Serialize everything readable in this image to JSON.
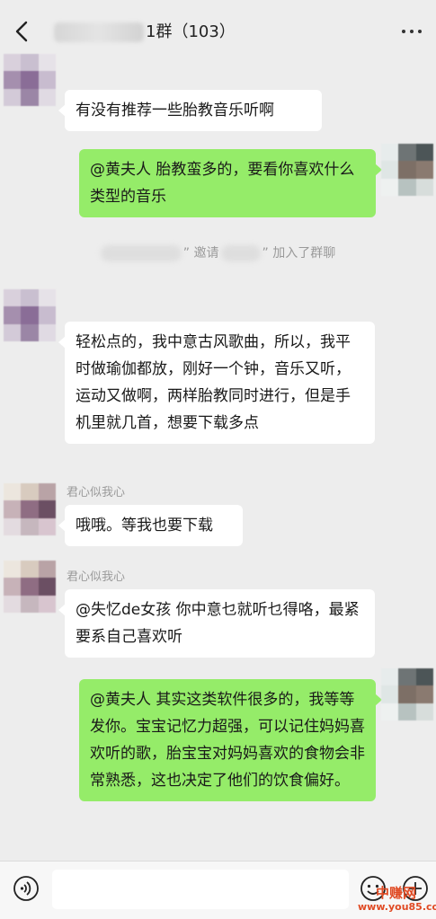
{
  "header": {
    "back_icon": "chevron-left-icon",
    "title": "1群（103）",
    "more_icon": "more-dots-icon"
  },
  "messages": [
    {
      "side": "left",
      "sender": "",
      "text": "有没有推荐一些胎教音乐听啊"
    },
    {
      "side": "right",
      "text": "@黄夫人 胎教蛮多的，要看你喜欢什么类型的音乐"
    },
    {
      "side": "left",
      "sender": "",
      "text": "轻松点的，我中意古风歌曲，所以，我平时做瑜伽都放，刚好一个钟，音乐又听，运动又做啊，两样胎教同时进行，但是手机里就几首，想要下载多点"
    },
    {
      "side": "left",
      "sender": "君心似我心",
      "text": "哦哦。等我也要下载"
    },
    {
      "side": "left",
      "sender": "君心似我心",
      "text": "@失忆de女孩 你中意乜就听乜得咯，最紧要系自己喜欢听"
    },
    {
      "side": "right",
      "text": "@黄夫人 其实这类软件很多的，我等等发你。宝宝记忆力超强，可以记住妈妈喜欢听的歌，胎宝宝对妈妈喜欢的食物会非常熟悉，这也决定了他们的饮食偏好。"
    }
  ],
  "system_message": {
    "part1": "” 邀请",
    "part2": "” 加入了群聊"
  },
  "bottom": {
    "voice_icon": "voice-icon",
    "emoji_icon": "emoji-icon",
    "plus_icon": "plus-icon",
    "input_value": ""
  },
  "watermark": {
    "name": "中赚网",
    "url": "www.you85.com"
  },
  "colors": {
    "background": "#ededed",
    "bubble_self": "#95ec69",
    "bubble_other": "#ffffff",
    "watermark": "#e04a23"
  }
}
